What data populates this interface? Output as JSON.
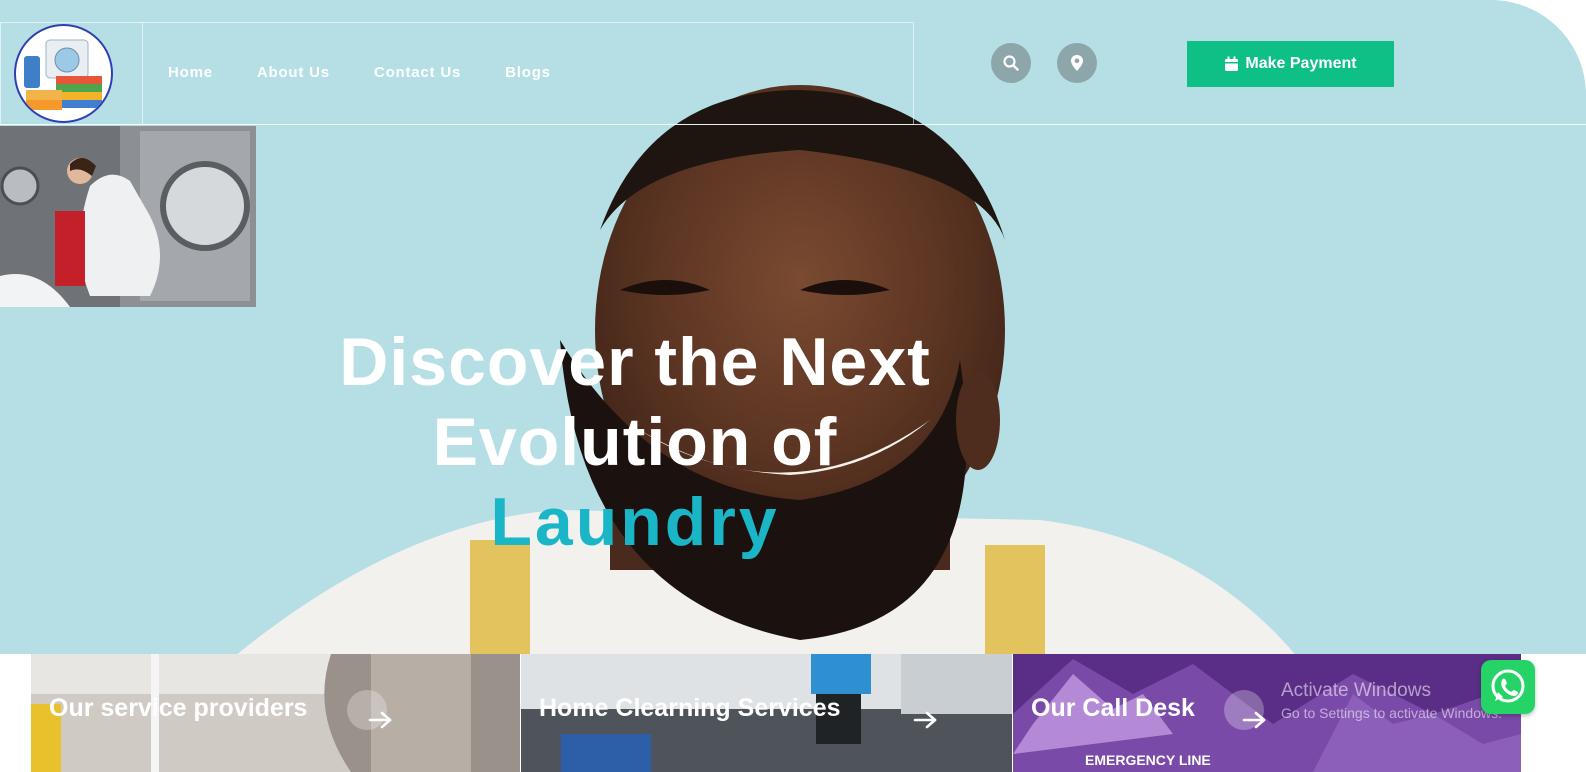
{
  "header": {
    "nav_items": [
      {
        "label": "Home"
      },
      {
        "label": "About Us"
      },
      {
        "label": "Contact Us"
      },
      {
        "label": "Blogs"
      }
    ],
    "search_icon": "search-icon",
    "location_icon": "map-marker-icon",
    "payment_button": {
      "icon": "calendar-icon",
      "label": "Make Payment"
    }
  },
  "hero": {
    "headline_line1": "Discover the Next",
    "headline_line2": "Evolution of",
    "headline_accent": "Laundry"
  },
  "cards": [
    {
      "title": "Our service providers",
      "icon": "arrow-right-icon"
    },
    {
      "title": "Home Clearning Services",
      "icon": "arrow-right-icon"
    },
    {
      "title": "Our Call Desk",
      "icon": "arrow-right-icon",
      "subtitle": "EMERGENCY LINE"
    }
  ],
  "watermark": {
    "title": "Activate Windows",
    "subtitle": "Go to Settings to activate Windows."
  },
  "whatsapp_icon": "whatsapp-icon",
  "colors": {
    "hero_background": "#b5dfe4",
    "accent_teal": "#1ab6c8",
    "payment_green": "#0fc086",
    "card3_purple": "#5a2d86"
  }
}
